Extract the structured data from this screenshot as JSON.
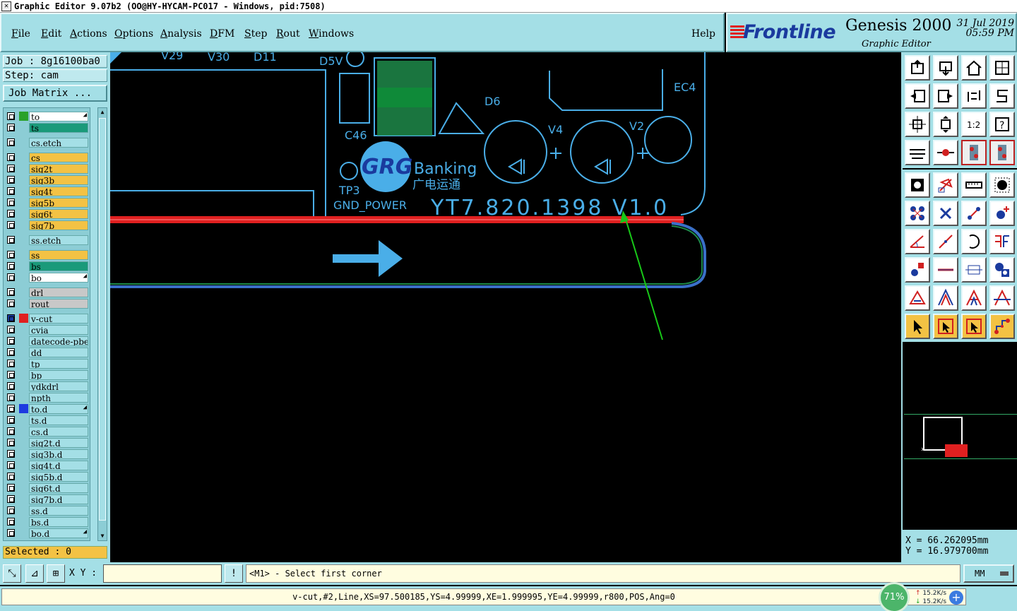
{
  "window": {
    "title": "Graphic Editor 9.07b2 (OO@HY-HYCAM-PC017 - Windows, pid:7508)"
  },
  "menu": {
    "items": [
      "File",
      "Edit",
      "Actions",
      "Options",
      "Analysis",
      "DFM",
      "Step",
      "Rout",
      "Windows"
    ],
    "help": "Help"
  },
  "logo": {
    "brand": "Frontline",
    "product": "Genesis 2000",
    "subtitle": "Graphic Editor",
    "date": "31 Jul 2019",
    "time": "05:59 PM"
  },
  "left": {
    "job": "Job : 8g16100ba0",
    "step": "Step: cam",
    "job_matrix": "Job Matrix ...",
    "selected": "Selected : 0",
    "layers": [
      {
        "name": "to",
        "bg": "#ffffff",
        "swatch": "#2aa12a",
        "arrow": true
      },
      {
        "name": "ts",
        "bg": "#1a9a7a",
        "swatch": ""
      },
      {
        "name": "cs.etch",
        "bg": "#a4dfe6",
        "swatch": "",
        "gap": true
      },
      {
        "name": "cs",
        "bg": "#f3c244",
        "swatch": "",
        "gap": true
      },
      {
        "name": "sig2t",
        "bg": "#f3c244",
        "swatch": ""
      },
      {
        "name": "sig3b",
        "bg": "#f3c244",
        "swatch": ""
      },
      {
        "name": "sig4t",
        "bg": "#f3c244",
        "swatch": ""
      },
      {
        "name": "sig5b",
        "bg": "#f3c244",
        "swatch": ""
      },
      {
        "name": "sig6t",
        "bg": "#f3c244",
        "swatch": ""
      },
      {
        "name": "sig7b",
        "bg": "#f3c244",
        "swatch": ""
      },
      {
        "name": "ss.etch",
        "bg": "#a4dfe6",
        "swatch": "",
        "gap": true
      },
      {
        "name": "ss",
        "bg": "#f3c244",
        "swatch": "",
        "gap": true
      },
      {
        "name": "bs",
        "bg": "#1a9a7a",
        "swatch": ""
      },
      {
        "name": "bo",
        "bg": "#ffffff",
        "swatch": "",
        "arrow": true
      },
      {
        "name": "drl",
        "bg": "#c8c8c8",
        "swatch": "",
        "gap": true
      },
      {
        "name": "rout",
        "bg": "#c8c8c8",
        "swatch": ""
      },
      {
        "name": "v-cut",
        "bg": "#a4dfe6",
        "swatch": "#e02020",
        "gap": true,
        "active": true
      },
      {
        "name": "cvia",
        "bg": "#a4dfe6",
        "swatch": ""
      },
      {
        "name": "datecode-pbe",
        "bg": "#a4dfe6",
        "swatch": ""
      },
      {
        "name": "dd",
        "bg": "#a4dfe6",
        "swatch": ""
      },
      {
        "name": "tp",
        "bg": "#a4dfe6",
        "swatch": ""
      },
      {
        "name": "bp",
        "bg": "#a4dfe6",
        "swatch": ""
      },
      {
        "name": "ydkdrl",
        "bg": "#a4dfe6",
        "swatch": ""
      },
      {
        "name": "npth",
        "bg": "#a4dfe6",
        "swatch": ""
      },
      {
        "name": "to.d",
        "bg": "#a4dfe6",
        "swatch": "#1d3ae0",
        "arrow": true
      },
      {
        "name": "ts.d",
        "bg": "#a4dfe6",
        "swatch": ""
      },
      {
        "name": "cs.d",
        "bg": "#a4dfe6",
        "swatch": ""
      },
      {
        "name": "sig2t.d",
        "bg": "#a4dfe6",
        "swatch": ""
      },
      {
        "name": "sig3b.d",
        "bg": "#a4dfe6",
        "swatch": ""
      },
      {
        "name": "sig4t.d",
        "bg": "#a4dfe6",
        "swatch": ""
      },
      {
        "name": "sig5b.d",
        "bg": "#a4dfe6",
        "swatch": ""
      },
      {
        "name": "sig6t.d",
        "bg": "#a4dfe6",
        "swatch": ""
      },
      {
        "name": "sig7b.d",
        "bg": "#a4dfe6",
        "swatch": ""
      },
      {
        "name": "ss.d",
        "bg": "#a4dfe6",
        "swatch": ""
      },
      {
        "name": "bs.d",
        "bg": "#a4dfe6",
        "swatch": ""
      },
      {
        "name": "bo.d",
        "bg": "#a4dfe6",
        "swatch": "",
        "arrow": true
      }
    ]
  },
  "canvas": {
    "labels": {
      "v29": "V29",
      "v30": "V30",
      "d11": "D11",
      "d5v": "D5V",
      "d6": "D6",
      "ec4": "EC4",
      "v4": "V4",
      "v2": "V2",
      "c46": "C46",
      "tp3": "TP3",
      "gnd_power": "GND_POWER",
      "grg": "GRG",
      "banking": "Banking",
      "cn_text": "广电运通",
      "board_id": "YT7.820.1398 V1.0"
    },
    "colors": {
      "silk": "#4aaee8",
      "vcut": "#e02020",
      "arrow": "#18c818",
      "outline": "#3a70c8"
    }
  },
  "right": {
    "coord_x": "X = 66.262095mm",
    "coord_y": "Y = 16.979700mm"
  },
  "command": {
    "xy_label": "X Y :",
    "xy_value": "",
    "prompt": "<M1> - Select first corner",
    "units": "MM"
  },
  "status": {
    "feature": "v-cut,#2,Line,XS=97.500185,YS=4.99999,XE=1.999995,YE=4.99999,r800,POS,Ang=0",
    "cpu": "71%",
    "up": "15.2K/s",
    "down": "15.2K/s"
  },
  "icons": {
    "top_tools": [
      "export-icon",
      "import-icon",
      "home-icon",
      "window-icon",
      "prev-step-icon",
      "next-step-icon",
      "swap-icon",
      "s-shape-icon",
      "fit-icon",
      "zoom-icon",
      "scale-1-2-icon",
      "help-icon",
      "measure-tool-icon",
      "connect-icon",
      "layer-board-icon",
      "layer-board-red-icon"
    ],
    "bottom_tools": [
      "feature-icon",
      "transform-icon",
      "ruler-icon",
      "pad-icon",
      "connect-nodes-icon",
      "cross-icon",
      "line-pad-icon",
      "add-pad-icon",
      "angle-icon",
      "slash-line-icon",
      "arc-icon",
      "flip-icon",
      "circle-pad-icon",
      "dash-line-icon",
      "fit-box-icon",
      "blocks-icon",
      "triangle-icon",
      "triangle-outline-icon",
      "arch-icon",
      "arch-strike-icon",
      "pointer-icon",
      "pointer-box-icon",
      "pointer-box-alt-icon",
      "route-icon"
    ]
  }
}
